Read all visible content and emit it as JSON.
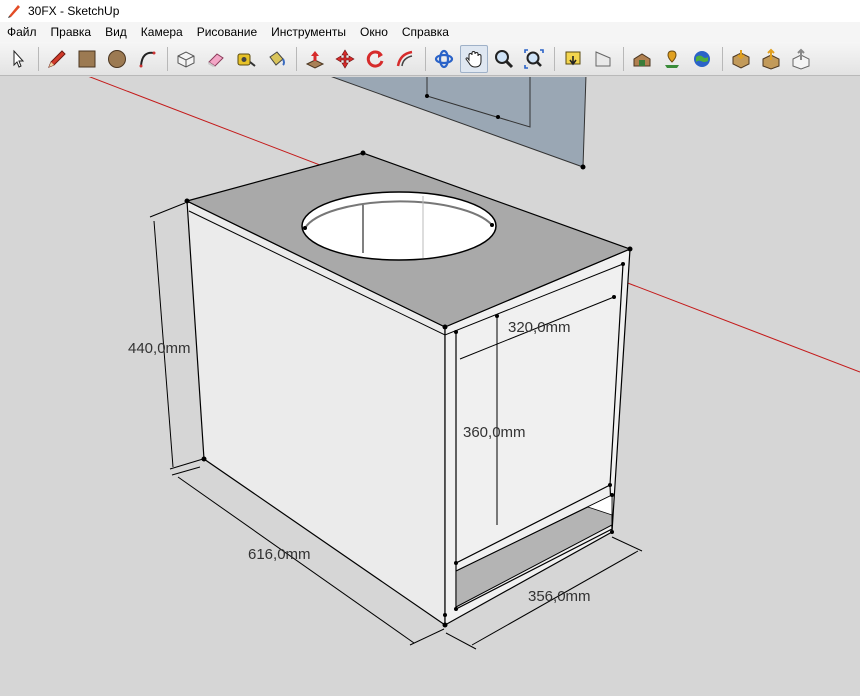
{
  "window": {
    "title": "30FX - SketchUp"
  },
  "menu": {
    "items": [
      "Файл",
      "Правка",
      "Вид",
      "Камера",
      "Рисование",
      "Инструменты",
      "Окно",
      "Справка"
    ]
  },
  "toolbar": {
    "tools": [
      "select-icon",
      "pencil-icon",
      "rectangle-icon",
      "circle-icon",
      "arc-icon",
      "make-component-icon",
      "eraser-icon",
      "tape-measure-icon",
      "paint-bucket-icon",
      "push-pull-icon",
      "move-icon",
      "rotate-icon",
      "offset-icon",
      "orbit-icon",
      "pan-icon",
      "zoom-icon",
      "zoom-extents-icon",
      "previous-view-icon",
      "next-view-icon",
      "3d-warehouse-icon",
      "add-location-icon",
      "google-earth-icon",
      "get-models-icon",
      "share-model-icon",
      "share-component-icon"
    ],
    "active_tool": "pan-icon"
  },
  "model": {
    "dimensions": {
      "height": "440,0mm",
      "depth": "616,0mm",
      "port_width": "320,0mm",
      "port_height": "360,0mm",
      "front_width": "356,0mm"
    },
    "colors": {
      "background": "#d6d6d6",
      "top_face": "#a9a9a9",
      "side_face": "#ededed",
      "front_face": "#f2f2f2",
      "edge": "#000000",
      "red_axis": "#c41a1a",
      "back_panel": "#9aa7b4",
      "port_interior": "#b4b4b4"
    }
  }
}
